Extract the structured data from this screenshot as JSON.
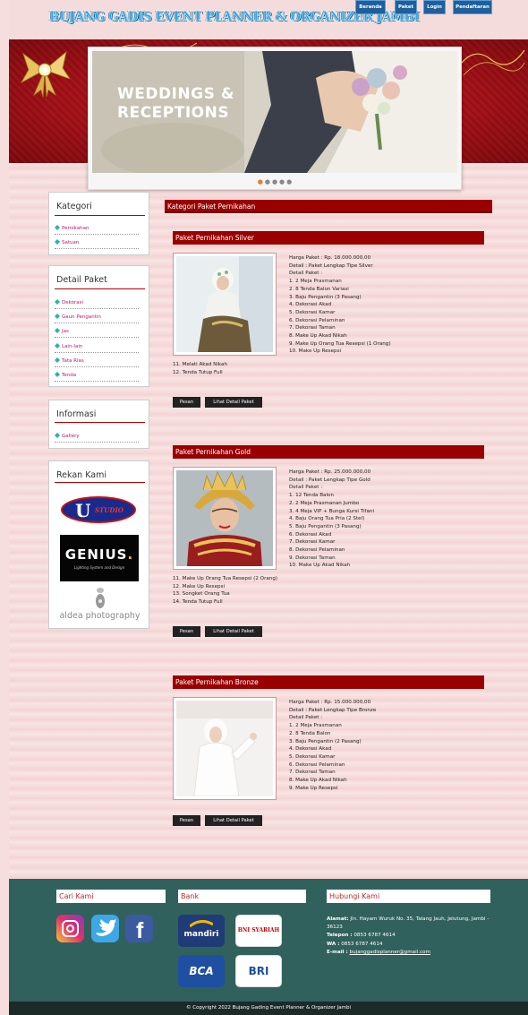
{
  "header": {
    "logo_text": "BUJANG GADIS EVENT PLANNER & ORGANIZER JAMBI",
    "nav": [
      "Beranda",
      "Paket",
      "Login",
      "Pendaftaran"
    ]
  },
  "banner": {
    "line1": "WEDDINGS &",
    "line2": "RECEPTIONS",
    "dots": 5,
    "active_dot": 0
  },
  "sidebar": {
    "kategori": {
      "title": "Kategori",
      "items": [
        "Pernikahan",
        "Satuan"
      ]
    },
    "detail": {
      "title": "Detail Paket",
      "items": [
        "Dekorasi",
        "Gaun Pengantin",
        "Jas",
        "Lain-lain",
        "Tata Rias",
        "Tenda"
      ]
    },
    "informasi": {
      "title": "Informasi",
      "items": [
        "Gallery"
      ]
    },
    "rekan": {
      "title": "Rekan Kami",
      "logos": [
        "U STUDIO",
        "GENIUS.",
        "aldea photography"
      ],
      "genius_sub": "Lighting System and Design"
    }
  },
  "main": {
    "category_title": "Kategori Paket Pernikahan",
    "packages": [
      {
        "title": "Paket Pernikahan Silver",
        "price": "Harga Paket : Rp. 18.000.000,00",
        "detail": "Detail : Paket Lengkap Tipe Silver",
        "detail_label": "Detail Paket :",
        "items": [
          "1. 2 Meja Prasmanan",
          "2. 8 Tenda Balon Variasi",
          "3. Baju Pengantin (3 Pasang)",
          "4. Dekorasi Akad",
          "5. Dekorasi Kamar",
          "6. Dekorasi Pelaminan",
          "7. Dekorasi Taman",
          "8. Make Up Akad Nikah",
          "9. Make Up Orang Tua Resepsi (1 Orang)",
          "10. Make Up Resepsi"
        ],
        "overflow": [
          "11. Melati Akad Nikah",
          "12. Tenda Tutup Full"
        ],
        "btn_order": "Pesan",
        "btn_detail": "Lihat Detail Paket"
      },
      {
        "title": "Paket Pernikahan Gold",
        "price": "Harga Paket : Rp. 25.000.000,00",
        "detail": "Detail : Paket Lengkap Tipe Gold",
        "detail_label": "Detail Paket :",
        "items": [
          "1. 12 Tenda Balon",
          "2. 2 Meja Prasmanan Jumbo",
          "3. 4 Meja VIP + Bunga Kursi Tifani",
          "4. Baju Orang Tua Pria (2 Stel)",
          "5. Baju Pengantin (3 Pasang)",
          "6. Dekorasi Akad",
          "7. Dekorasi Kamar",
          "8. Dekorasi Pelaminan",
          "9. Dekorasi Taman",
          "10. Make Up Akad Nikah"
        ],
        "overflow": [
          "11. Make Up Orang Tua Resepsi (2 Orang)",
          "12. Make Up Resepsi",
          "13. Songket Orang Tua",
          "14. Tenda Tutup Full"
        ],
        "btn_order": "Pesan",
        "btn_detail": "Lihat Detail Paket"
      },
      {
        "title": "Paket Pernikahan Bronze",
        "price": "Harga Paket : Rp. 15.000.000,00",
        "detail": "Detail : Paket Lengkap Tipe Bronze",
        "detail_label": "Detail Paket :",
        "items": [
          "1. 2 Meja Prasmanan",
          "2. 8 Tenda Balon",
          "3. Baju Pengantin (2 Pasang)",
          "4. Dekorasi Akad",
          "5. Dekorasi Kamar",
          "6. Dekorasi Pelaminan",
          "7. Dekorasi Taman",
          "8. Make Up Akad Nikah",
          "9. Make Up Resepsi"
        ],
        "overflow": [],
        "btn_order": "Pesan",
        "btn_detail": "Lihat Detail Paket"
      }
    ]
  },
  "footer": {
    "cari_title": "Cari Kami",
    "bank_title": "Bank",
    "hubungi_title": "Hubungi Kami",
    "banks": [
      "mandiri",
      "BNI SYARIAH",
      "BCA",
      "BRI"
    ],
    "alamat_label": "Alamat:",
    "alamat": "Jln. Hayam Wuruk No. 35, Talang Jauh, Jelutung, Jambi - 36123",
    "telepon_label": "Telepon :",
    "telepon": "0853 6787 4614",
    "wa_label": "WA :",
    "wa": "0853 6787 4614",
    "email_label": "E-mail :",
    "email": "bujanggadisplanner@gmail.com",
    "copyright": "© Copyright 2022 Bujang Gading Event Planner & Organizer Jambi"
  },
  "colors": {
    "header_bar": "#9b0000",
    "nav": "#1f5f9c",
    "footer": "#31615c",
    "link": "#b5176f"
  }
}
